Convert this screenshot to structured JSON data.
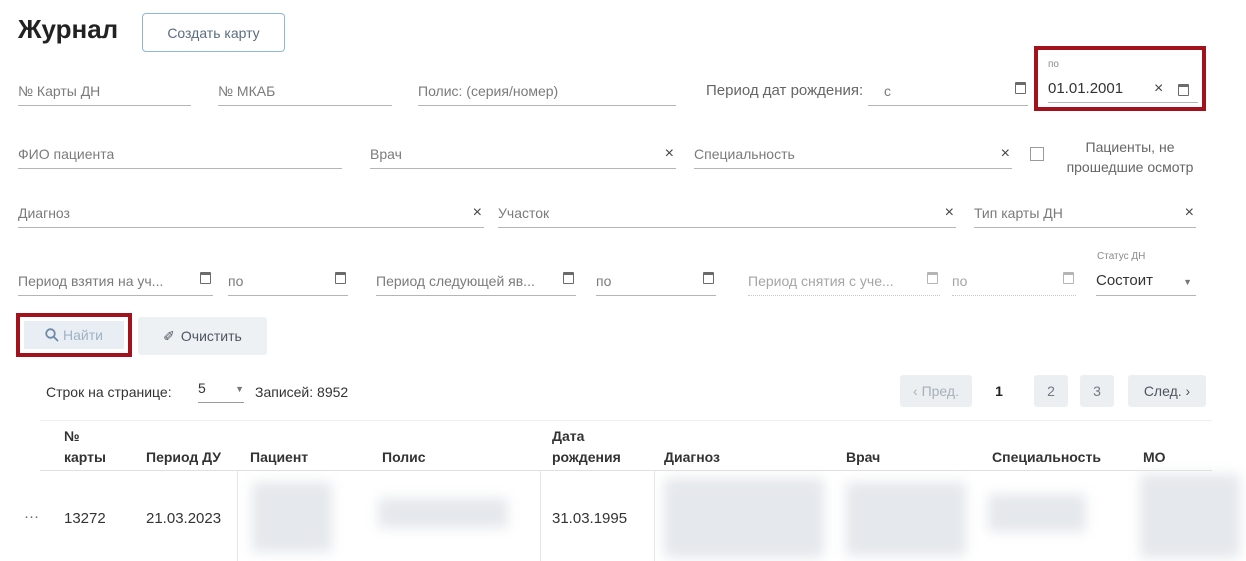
{
  "header": {
    "title": "Журнал",
    "create_card_label": "Создать карту"
  },
  "filters": {
    "card_no": "№ Карты ДН",
    "mkab_no": "№ МКАБ",
    "policy": "Полис: (серия/номер)",
    "birth_period_label": "Период дат рождения:",
    "birth_from_placeholder": "с",
    "birth_to_label": "по",
    "birth_to_value": "01.01.2001",
    "patient_name": "ФИО пациента",
    "doctor": "Врач",
    "specialty": "Специальность",
    "not_examined_label": "Пациенты, не прошедшие осмотр",
    "diagnosis": "Диагноз",
    "area": "Участок",
    "card_type": "Тип карты ДН",
    "take_period": "Период взятия на уч...",
    "take_to": "по",
    "next_visit_period": "Период следующей яв...",
    "next_visit_to": "по",
    "removal_period": "Период снятия с уче...",
    "removal_to": "по",
    "status_label": "Статус ДН",
    "status_value": "Состоит"
  },
  "actions": {
    "find_label": "Найти",
    "clear_label": "Очистить"
  },
  "pagination": {
    "rows_per_page_label": "Строк на странице:",
    "rows_per_page_value": "5",
    "records_label": "Записей:",
    "records_count": "8952",
    "prev_label": "‹ Пред.",
    "pages": [
      "1",
      "2",
      "3"
    ],
    "current_page": "1",
    "next_label": "След. ›"
  },
  "table": {
    "columns": {
      "card_no_1": "№",
      "card_no_2": "карты",
      "period": "Период ДУ",
      "patient": "Пациент",
      "policy": "Полис",
      "birth_1": "Дата",
      "birth_2": "рождения",
      "diagnosis": "Диагноз",
      "doctor": "Врач",
      "specialty": "Специальность",
      "mo": "МО"
    },
    "rows": [
      {
        "menu": "···",
        "card_no": "13272",
        "period": "21.03.2023",
        "birth_date": "31.03.1995"
      }
    ]
  },
  "colors": {
    "highlight": "#a3121c",
    "accent": "#8fb8d8"
  }
}
